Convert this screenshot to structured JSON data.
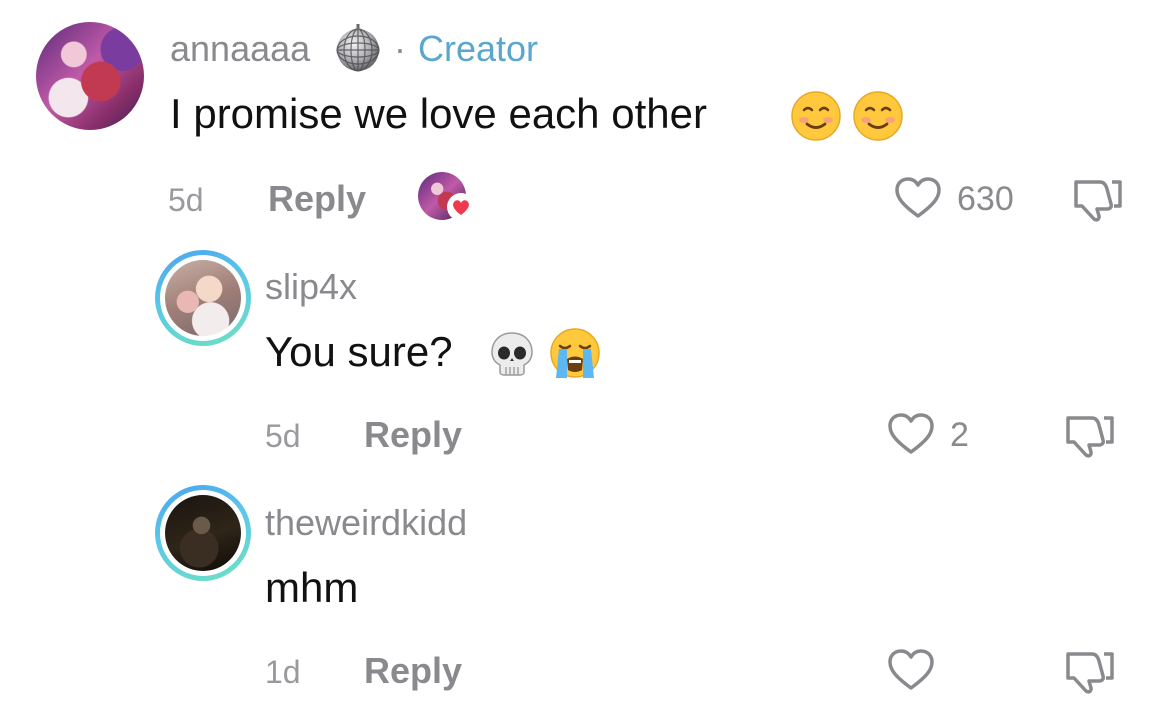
{
  "comments": [
    {
      "username": "annaaaa",
      "badge": "Creator",
      "separator": "·",
      "text": "I promise we love each other",
      "emojis": [
        "smiling-face-icon",
        "smiling-face-icon"
      ],
      "time": "5d",
      "reply_label": "Reply",
      "likes": "630",
      "liked_by_creator": true
    },
    {
      "username": "slip4x",
      "text": "You sure?",
      "emojis": [
        "skull-icon",
        "loudly-crying-face-icon"
      ],
      "time": "5d",
      "reply_label": "Reply",
      "likes": "2"
    },
    {
      "username": "theweirdkidd",
      "text": "mhm",
      "time": "1d",
      "reply_label": "Reply",
      "likes": ""
    }
  ],
  "colors": {
    "username": "#8a8a8e",
    "creator_badge": "#5aa6cc",
    "text": "#111111",
    "heart_badge": "#f0384f",
    "story_ring_start": "#4aa3f0",
    "story_ring_end": "#6ee2c0"
  }
}
